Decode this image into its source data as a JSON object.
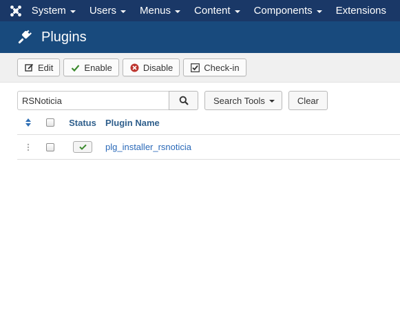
{
  "nav": {
    "items": [
      {
        "label": "System"
      },
      {
        "label": "Users"
      },
      {
        "label": "Menus"
      },
      {
        "label": "Content"
      },
      {
        "label": "Components"
      },
      {
        "label": "Extensions"
      }
    ]
  },
  "header": {
    "title": "Plugins"
  },
  "toolbar": {
    "edit_label": "Edit",
    "enable_label": "Enable",
    "disable_label": "Disable",
    "checkin_label": "Check-in"
  },
  "search": {
    "value": "RSNoticia",
    "tools_label": "Search Tools",
    "clear_label": "Clear"
  },
  "table": {
    "headers": {
      "status": "Status",
      "name": "Plugin Name"
    },
    "rows": [
      {
        "name": "plg_installer_rsnoticia",
        "enabled": true
      }
    ]
  },
  "colors": {
    "navbar": "#1a3867",
    "header": "#184a7d",
    "link": "#2a69b8",
    "enabled_check": "#3c8a2e",
    "disable_icon": "#bd362f"
  }
}
